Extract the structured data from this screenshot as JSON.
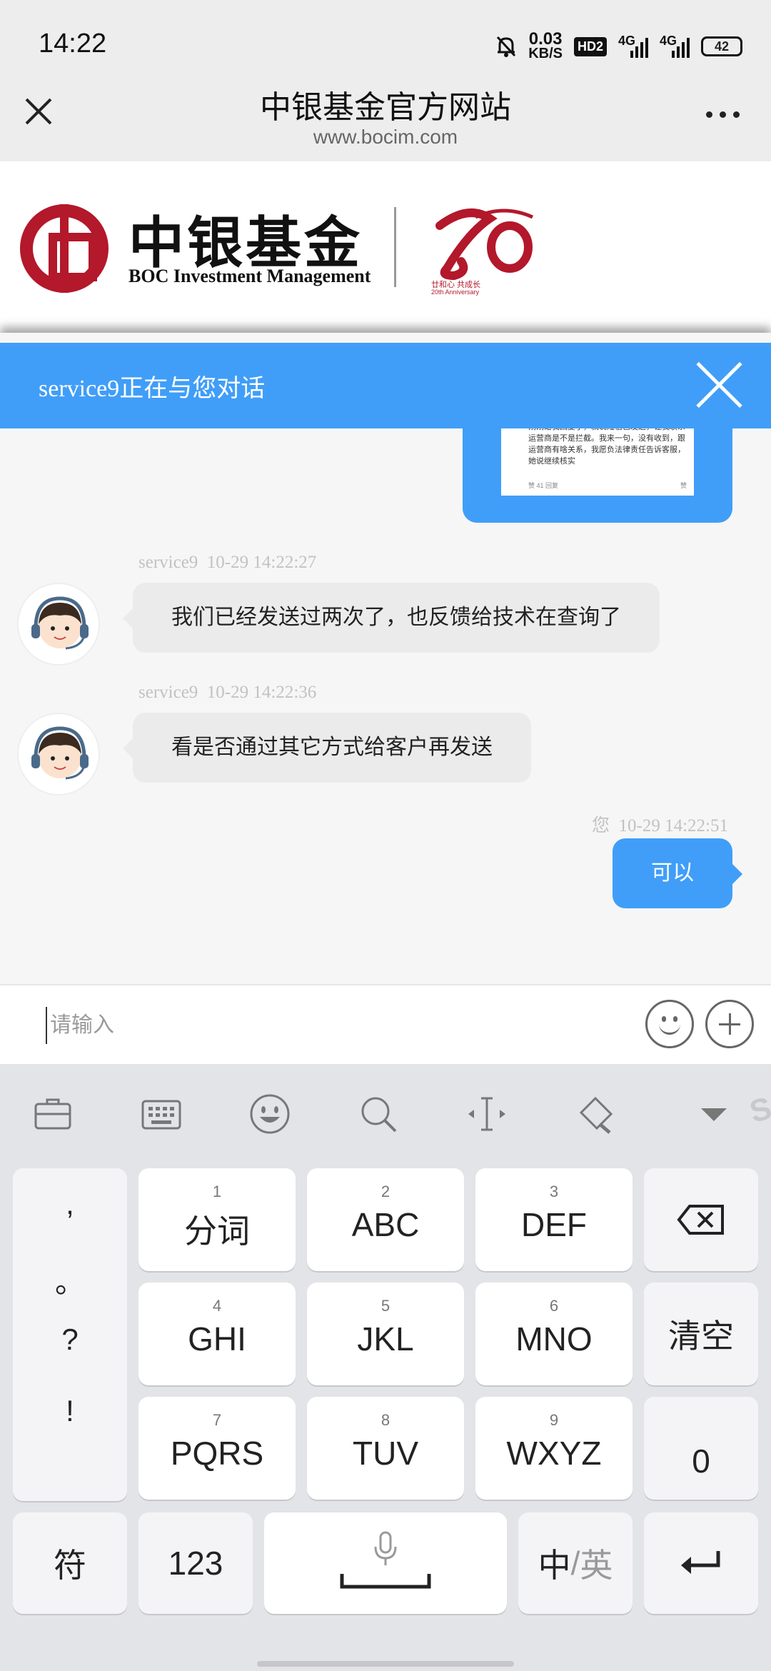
{
  "status_bar": {
    "time": "14:22",
    "speed_value": "0.03",
    "speed_unit": "KB/S",
    "hd_badge": "HD2",
    "net1": "4G",
    "net2": "4G",
    "battery": "42"
  },
  "title_bar": {
    "title": "中银基金官方网站",
    "url": "www.bocim.com"
  },
  "bank_header": {
    "name_cn": "中银基金",
    "name_en": "BOC Investment Management",
    "anniversary_caption": "20th Anniversary",
    "anniversary_slogan": "廿和心 共成长"
  },
  "chat": {
    "header_title": "service9正在与您对话",
    "image_message_text": "刚刚给我回复了，就说短信已发送，让我联系运营商是不是拦截。我来一句，没有收到，跟运营商有啥关系，我愿负法律责任告诉客服，她说继续核实",
    "image_message_footer_left": "赞 41  回复",
    "image_message_footer_right": "赞",
    "messages": [
      {
        "sender": "service9",
        "time": "10-29 14:22:27",
        "text": "我们已经发送过两次了，也反馈给技术在查询了",
        "side": "left"
      },
      {
        "sender": "service9",
        "time": "10-29 14:22:36",
        "text": "看是否通过其它方式给客户再发送",
        "side": "left"
      },
      {
        "sender": "您",
        "time": "10-29 14:22:51",
        "text": "可以",
        "side": "right"
      }
    ],
    "input_placeholder": "请输入"
  },
  "keyboard": {
    "punctuation": [
      ",",
      "。",
      "?",
      "!"
    ],
    "keys": [
      {
        "num": "1",
        "label": "分词"
      },
      {
        "num": "2",
        "label": "ABC"
      },
      {
        "num": "3",
        "label": "DEF"
      },
      {
        "num": "4",
        "label": "GHI"
      },
      {
        "num": "5",
        "label": "JKL"
      },
      {
        "num": "6",
        "label": "MNO"
      },
      {
        "num": "7",
        "label": "PQRS"
      },
      {
        "num": "8",
        "label": "TUV"
      },
      {
        "num": "9",
        "label": "WXYZ"
      }
    ],
    "clear_label": "清空",
    "zero_label": "0",
    "symbols_label": "符",
    "numbers_label": "123",
    "lang_label_a": "中",
    "lang_label_sep": "/",
    "lang_label_b": "英",
    "sogou_mark": "S"
  },
  "colors": {
    "accent_blue": "#409ef8",
    "brand_red": "#b3182b"
  }
}
